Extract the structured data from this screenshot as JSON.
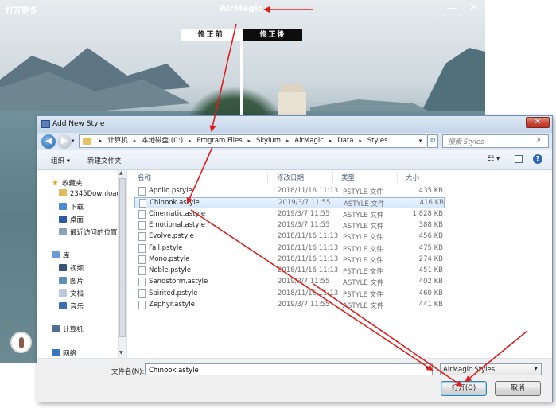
{
  "app": {
    "title": "AirMagic",
    "menu_label": "打开更多",
    "minimize_glyph": "—",
    "close_glyph": "✕",
    "before_label": "修正前",
    "after_label": "修正後"
  },
  "dialog": {
    "title": "Add New Style",
    "close_glyph": "✕",
    "address": {
      "back_glyph": "◀",
      "forward_glyph": "▶",
      "drop_glyph": "▾",
      "crumbs": [
        "计算机",
        "本地磁盘 (C:)",
        "Program Files",
        "Skylum",
        "AirMagic",
        "Data",
        "Styles"
      ],
      "sep_glyph": "▸",
      "refresh_glyph": "↻",
      "search_placeholder": "搜索 Styles",
      "search_icon_glyph": "⌕"
    },
    "toolbar": {
      "organize": "组织 ▾",
      "new_folder": "新建文件夹",
      "view_glyph": "☷ ▾",
      "help_glyph": "?"
    },
    "nav": {
      "favorites": "收藏夹",
      "downloads_folder": "2345Downloads",
      "downloads": "下载",
      "desktop": "桌面",
      "recent": "最近访问的位置",
      "libraries": "库",
      "videos": "视频",
      "pictures": "图片",
      "documents": "文档",
      "music": "音乐",
      "computer": "计算机",
      "network": "网络",
      "scroll_up": "▲",
      "scroll_down": "▼"
    },
    "columns": {
      "name": "名称",
      "date": "修改日期",
      "type": "类型",
      "size": "大小"
    },
    "files": [
      {
        "name": "Apollo.pstyle",
        "date": "2018/11/16 11:13",
        "type": "PSTYLE 文件",
        "size": "435 KB"
      },
      {
        "name": "Chinook.astyle",
        "date": "2019/3/7 11:55",
        "type": "ASTYLE 文件",
        "size": "416 KB",
        "selected": true
      },
      {
        "name": "Cinematic.astyle",
        "date": "2019/3/7 11:55",
        "type": "ASTYLE 文件",
        "size": "1,828 KB"
      },
      {
        "name": "Emotional.astyle",
        "date": "2019/3/7 11:55",
        "type": "ASTYLE 文件",
        "size": "388 KB"
      },
      {
        "name": "Evolve.pstyle",
        "date": "2018/11/16 11:13",
        "type": "PSTYLE 文件",
        "size": "456 KB"
      },
      {
        "name": "Fall.pstyle",
        "date": "2018/11/16 11:13",
        "type": "PSTYLE 文件",
        "size": "475 KB"
      },
      {
        "name": "Mono.pstyle",
        "date": "2018/11/16 11:13",
        "type": "PSTYLE 文件",
        "size": "274 KB"
      },
      {
        "name": "Noble.pstyle",
        "date": "2018/11/16 11:13",
        "type": "PSTYLE 文件",
        "size": "451 KB"
      },
      {
        "name": "Sandstorm.astyle",
        "date": "2019/3/7 11:55",
        "type": "ASTYLE 文件",
        "size": "402 KB"
      },
      {
        "name": "Spirited.pstyle",
        "date": "2018/11/16 11:13",
        "type": "PSTYLE 文件",
        "size": "460 KB"
      },
      {
        "name": "Zephyr.astyle",
        "date": "2019/3/7 11:55",
        "type": "ASTYLE 文件",
        "size": "441 KB"
      }
    ],
    "bottom": {
      "filename_label": "文件名(N):",
      "filename_value": "Chinook.astyle",
      "filetype": "AirMagic Styles",
      "drop_glyph": "▼",
      "open": "打开(O)",
      "cancel": "取消"
    }
  },
  "colors": {
    "annotation_arrow": "#e01d1d",
    "selection_border": "#8fb7e6",
    "dialog_border": "#6b8fb5"
  }
}
